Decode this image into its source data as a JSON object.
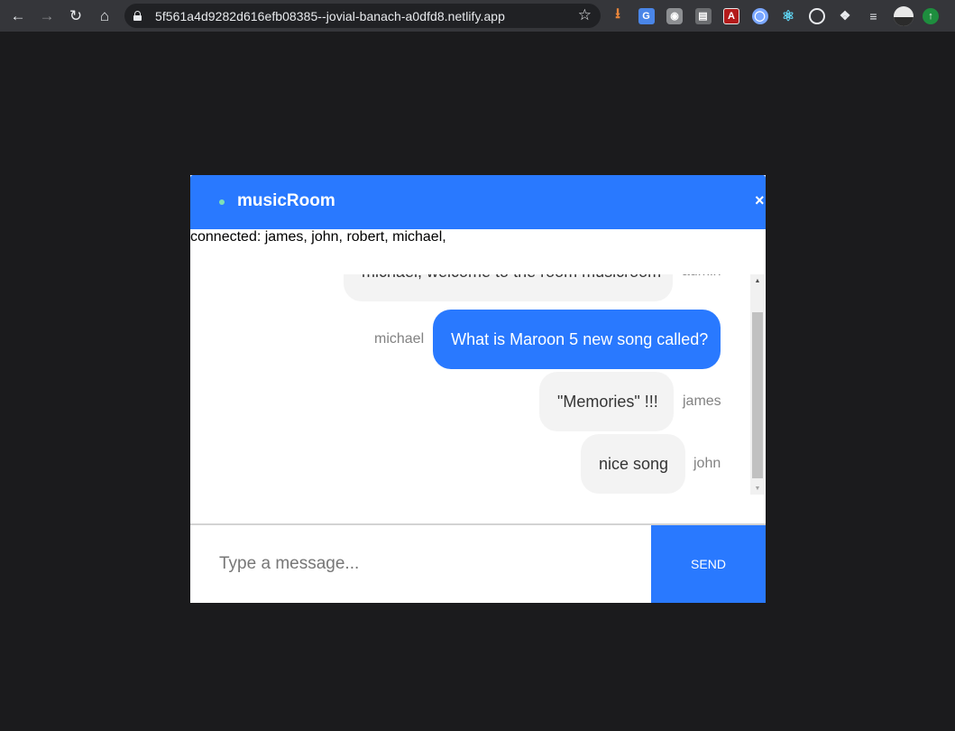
{
  "browser": {
    "url": "5f561a4d9282d616efb08385--jovial-banach-a0dfd8.netlify.app",
    "icons": {
      "back": "arrow-left-icon",
      "forward": "arrow-right-icon",
      "reload": "reload-icon",
      "home": "home-icon",
      "lock": "lock-icon",
      "bookmark": "star-icon"
    },
    "extensions": [
      "download",
      "translate",
      "lighthouse",
      "screenshot",
      "pdf",
      "ring",
      "react-devtools",
      "target",
      "extensions-puzzle",
      "reading-queue",
      "profile-avatar",
      "update"
    ]
  },
  "chat": {
    "room_name": "musicRoom",
    "close_symbol": "×",
    "connected_text": "connected: james, john, robert, michael,",
    "messages": [
      {
        "text": "michael, welcome to the room musicroom",
        "sender": "admin",
        "mine": false
      },
      {
        "text": "What is Maroon 5 new song called?",
        "sender": "michael",
        "mine": true
      },
      {
        "text": "\"Memories\" !!!",
        "sender": "james",
        "mine": false
      },
      {
        "text": "nice song",
        "sender": "john",
        "mine": false
      }
    ],
    "input": {
      "placeholder": "Type a message...",
      "value": ""
    },
    "send_label": "SEND"
  },
  "colors": {
    "accent": "#2979ff",
    "online": "#7ee0b5",
    "page_bg": "#1b1b1d",
    "bubble_other": "#f3f3f3"
  }
}
